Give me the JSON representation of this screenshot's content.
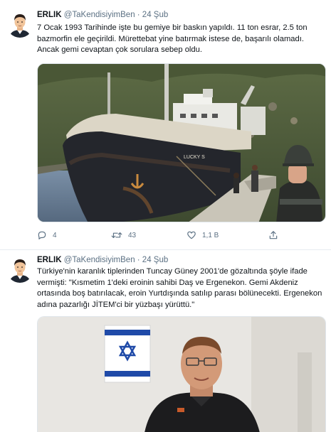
{
  "tweets": [
    {
      "author_name": "ERLIK",
      "handle_date": "@TaKendisiyimBen · 24 Şub",
      "text": "7 Ocak 1993 Tarihinde işte bu gemiye bir baskın yapıldı. 11 ton esrar, 2.5 ton bazmorfin ele geçirildi. Mürettebat yine batırmak istese de, başarılı olamadı. Ancak gemi cevaptan çok sorulara sebep oldu.",
      "image_text": "LUCKY S",
      "replies": "4",
      "retweets": "43",
      "likes": "1,1 B"
    },
    {
      "author_name": "ERLIK",
      "handle_date": "@TaKendisiyimBen · 24 Şub",
      "text": "Türkiye'nin karanlık tiplerinden Tuncay Güney 2001'de gözaltında şöyle ifade vermişti: \"Kısmetim 1'deki eroinin sahibi Daş ve Ergenekon. Gemi Akdeniz ortasında boş batırılacak, eroin Yurtdışında satılıp parası bölünecekti. Ergenekon adına pazarlığı JİTEM'ci bir yüzbaşı yürüttü.\""
    }
  ],
  "icons": {
    "reply": "reply-icon",
    "retweet": "retweet-icon",
    "like": "heart-icon",
    "share": "share-icon"
  },
  "colors": {
    "name": "#0f1419",
    "secondary": "#5b7083",
    "divider": "#e6ecf0"
  }
}
